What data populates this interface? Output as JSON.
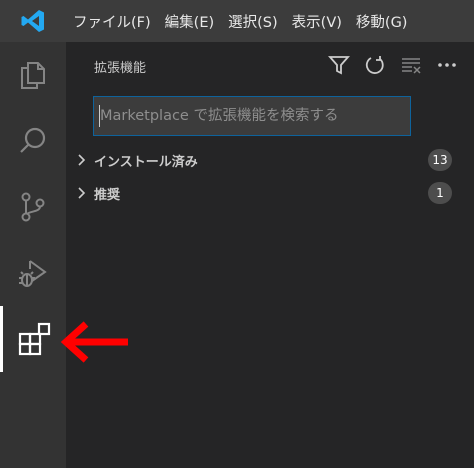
{
  "menu": {
    "items": [
      "ファイル(F)",
      "編集(E)",
      "選択(S)",
      "表示(V)",
      "移動(G)"
    ]
  },
  "activity_bar": {
    "icons": [
      "explorer-icon",
      "search-icon",
      "source-control-icon",
      "run-debug-icon",
      "extensions-icon"
    ],
    "active": "extensions"
  },
  "sidebar": {
    "title": "拡張機能",
    "search": {
      "placeholder": "Marketplace で拡張機能を検索する",
      "value": ""
    },
    "sections": [
      {
        "label": "インストール済み",
        "count": "13"
      },
      {
        "label": "推奨",
        "count": "1"
      }
    ]
  },
  "annotation": {
    "icon": "arrow-left-icon",
    "color": "#ff0000"
  },
  "colors": {
    "accent": "#0e639c",
    "titlebar": "#3c3c3c",
    "activitybar": "#333333",
    "sidebar": "#252526",
    "vscode_blue": "#23a9f2"
  }
}
